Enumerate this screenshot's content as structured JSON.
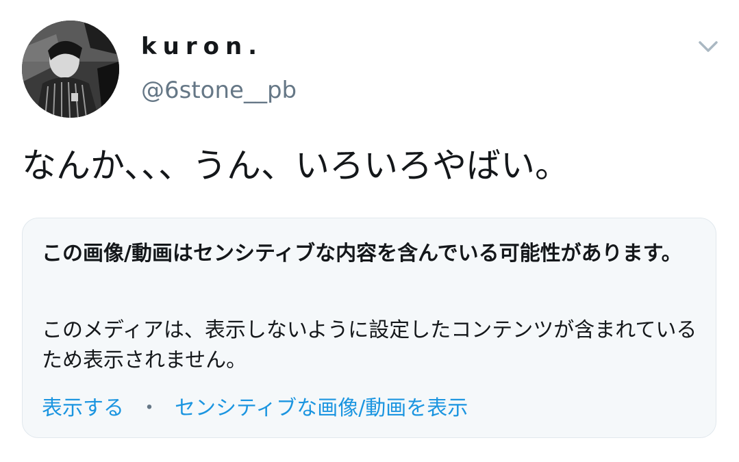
{
  "user": {
    "display_name": "kuron.",
    "handle": "@6stone__pb"
  },
  "tweet": {
    "text": "なんか、、、うん、いろいろやばい。"
  },
  "sensitive_notice": {
    "title": "この画像/動画はセンシティブな内容を含んでいる可能性があります。",
    "description": "このメディアは、表示しないように設定したコンテンツが含まれているため表示されません。",
    "show_link": "表示する",
    "separator": "・",
    "settings_link": "センシティブな画像/動画を表示"
  },
  "icons": {
    "menu": "chevron-down-icon",
    "avatar": "profile-photo"
  },
  "colors": {
    "link": "#1b95e0",
    "handle": "#657786",
    "card_bg": "#f5f8fa",
    "card_border": "#e1e8ed"
  }
}
